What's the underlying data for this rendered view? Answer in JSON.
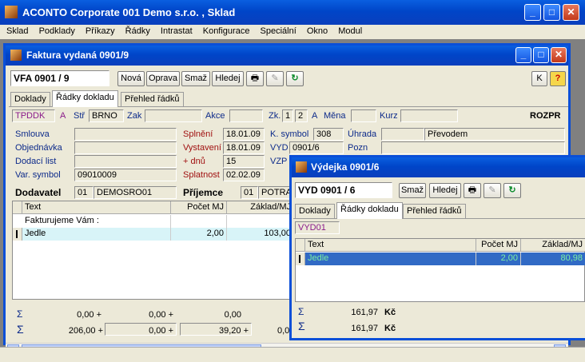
{
  "app": {
    "title": "ACONTO Corporate 001 Demo s.r.o. , Sklad"
  },
  "menu": [
    "Sklad",
    "Podklady",
    "Příkazy",
    "Řádky",
    "Intrastat",
    "Konfigurace",
    "Speciální",
    "Okno",
    "Modul"
  ],
  "invoice": {
    "title": "Faktura vydaná 0901/9",
    "doc_number": "VFA  0901  / 9",
    "buttons": {
      "nova": "Nová",
      "oprava": "Oprava",
      "smaz": "Smaž",
      "hledej": "Hledej",
      "k": "K",
      "help": "?"
    },
    "tabs": [
      "Doklady",
      "Řádky dokladu",
      "Přehled řádků"
    ],
    "row1": {
      "tpddk": "TPDDK",
      "a1": "A",
      "str_label": "Stř",
      "str_value": "BRNO",
      "zak_label": "Zak",
      "akce_label": "Akce",
      "zk_label": "Zk.",
      "zk1": "1",
      "zk2": "2",
      "a2": "A",
      "mena_label": "Měna",
      "kurz_label": "Kurz",
      "rozpr": "ROZPR"
    },
    "labels": {
      "smlouva": "Smlouva",
      "objednavka": "Objednávka",
      "dodaci": "Dodací list",
      "varsym": "Var. symbol",
      "dodavatel": "Dodavatel",
      "prijemce": "Příjemce",
      "splneni": "Splnění",
      "vystaveni": "Vystavení",
      "dnu": "+ dnů",
      "splatnost": "Splatnost",
      "ksymbol": "K. symbol",
      "vyd": "VYD",
      "vzp": "VZP",
      "uhrada": "Úhrada",
      "pozn": "Pozn"
    },
    "values": {
      "varsym": "09010009",
      "dod_num": "01",
      "dod_name": "DEMOSRO01",
      "prij_num": "01",
      "prij_name": "POTRA",
      "splneni": "18.01.09",
      "vystaveni": "18.01.09",
      "dnu": "15",
      "splatnost": "02.02.09",
      "ksymbol": "308",
      "vyd": "0901/6",
      "uhrada": "Převodem"
    },
    "grid": {
      "headers": [
        "Text",
        "Počet MJ",
        "Základ/MJ"
      ],
      "rows": [
        [
          "Fakturujeme Vám :",
          "",
          ""
        ],
        [
          "Jedle",
          "2,00",
          "103,00"
        ]
      ]
    },
    "totals": {
      "r1": [
        "0,00 +",
        "0,00 +",
        "0,00"
      ],
      "r2": [
        "206,00 +",
        "0,00 +",
        "39,20 +",
        "0,0"
      ]
    }
  },
  "vydejka": {
    "title": "Výdejka 0901/6",
    "doc_number": "VYD  0901  / 6",
    "buttons": {
      "smaz": "Smaž",
      "hledej": "Hledej"
    },
    "tabs": [
      "Doklady",
      "Řádky dokladu",
      "Přehled řádků"
    ],
    "code": "VYD01",
    "grid": {
      "headers": [
        "Text",
        "Počet MJ",
        "Základ/MJ"
      ],
      "rows": [
        [
          "Jedle",
          "2,00",
          "80,98"
        ]
      ]
    },
    "totals": [
      {
        "value": "161,97",
        "unit": "Kč"
      },
      {
        "value": "161,97",
        "unit": "Kč"
      }
    ]
  },
  "icons": {
    "sigma": "Σ"
  }
}
